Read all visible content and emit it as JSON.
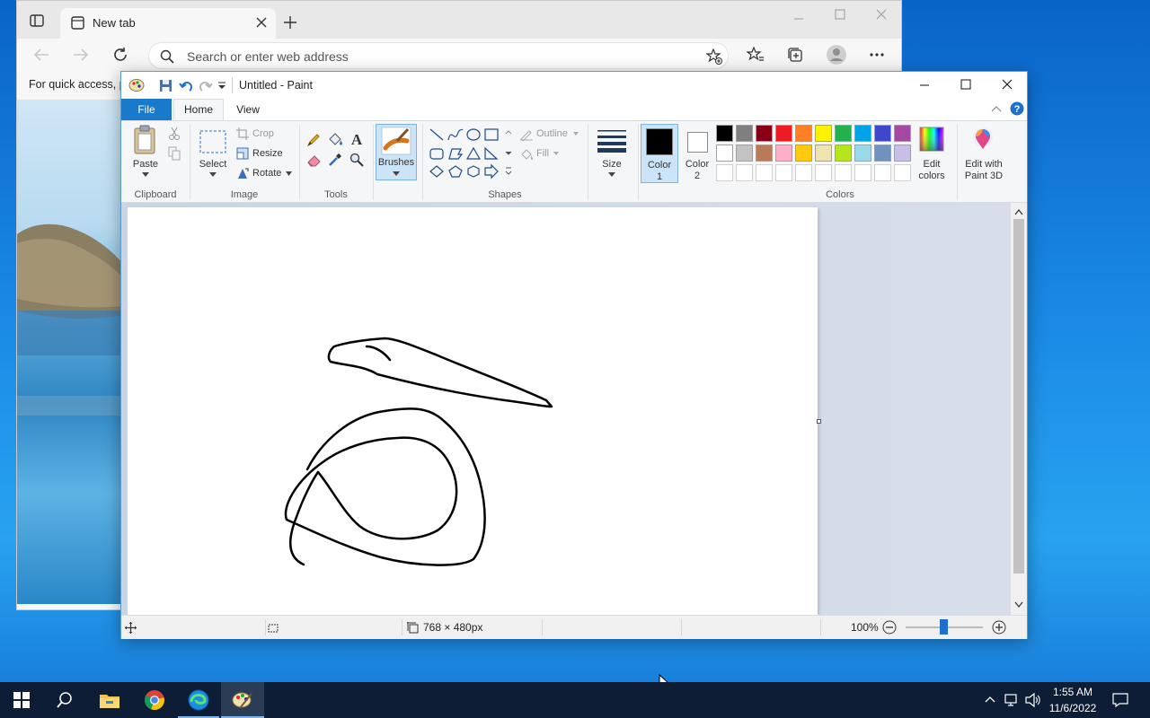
{
  "edge": {
    "tab_title": "New tab",
    "address_placeholder": "Search or enter web address",
    "favorites_hint": "For quick access, p"
  },
  "paint": {
    "title": "Untitled - Paint",
    "tabs": [
      "File",
      "Home",
      "View"
    ],
    "clipboard": {
      "paste": "Paste",
      "group": "Clipboard"
    },
    "image": {
      "select": "Select",
      "crop": "Crop",
      "resize": "Resize",
      "rotate": "Rotate",
      "group": "Image"
    },
    "tools": {
      "group": "Tools"
    },
    "brushes": {
      "label": "Brushes"
    },
    "shapes": {
      "outline": "Outline",
      "fill": "Fill",
      "group": "Shapes"
    },
    "size": {
      "label": "Size"
    },
    "color1": {
      "label": "Color",
      "num": "1"
    },
    "color2": {
      "label": "Color",
      "num": "2"
    },
    "colors": {
      "group": "Colors",
      "row1": [
        "#000000",
        "#7f7f7f",
        "#880015",
        "#ed1c24",
        "#ff7f27",
        "#fff200",
        "#22b14c",
        "#00a2e8",
        "#3f48cc",
        "#a349a4"
      ],
      "row2": [
        "#ffffff",
        "#c3c3c3",
        "#b97a57",
        "#ffaec9",
        "#ffc90e",
        "#efe4b0",
        "#b5e61d",
        "#99d9ea",
        "#7092be",
        "#c8bfe7"
      ],
      "edit": "Edit colors"
    },
    "paint3d": {
      "line1": "Edit with",
      "line2": "Paint 3D"
    },
    "status": {
      "dimensions": "768 × 480px",
      "zoom": "100%"
    }
  },
  "taskbar": {
    "time": "1:55 AM",
    "date": "11/6/2022"
  }
}
